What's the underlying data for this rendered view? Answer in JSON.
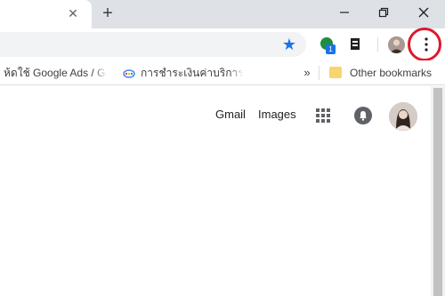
{
  "tabstrip": {
    "close_icon": "close-icon",
    "new_tab_label": "+",
    "window_controls": [
      "minimize-icon",
      "restore-icon",
      "close-icon"
    ]
  },
  "toolbar": {
    "star_icon": "star-icon",
    "star_color": "#1a73e8",
    "extension_badge": "1",
    "menu_icon": "vertical-dots-icon",
    "highlight_color": "#e0182d"
  },
  "bookmarks": {
    "items": [
      {
        "label": "ห้ดใช้ Google Ads / Go"
      },
      {
        "label": "การชำระเงินค่าบริการ Go"
      }
    ],
    "overflow_label": "»",
    "other_label": "Other bookmarks"
  },
  "page": {
    "gmail_label": "Gmail",
    "images_label": "Images",
    "apps_icon": "apps-grid-icon",
    "notifications_icon": "bell-icon"
  }
}
